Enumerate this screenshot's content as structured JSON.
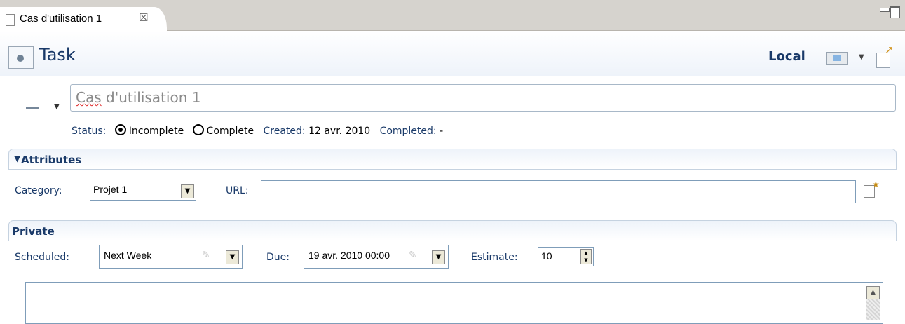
{
  "editor_tab": {
    "title": "Cas d'utilisation 1",
    "close_glyph": "☒"
  },
  "header": {
    "title": "Task",
    "repository": "Local"
  },
  "summary": {
    "value_spelled": "Cas",
    "value_rest": " d'utilisation 1"
  },
  "status": {
    "label": "Status:",
    "options": [
      "Incomplete",
      "Complete"
    ],
    "selected": "Incomplete",
    "created_label": "Created:",
    "created_value": "12 avr. 2010",
    "completed_label": "Completed:",
    "completed_value": "-"
  },
  "attributes": {
    "section_title": "Attributes",
    "category_label": "Category:",
    "category_value": "Projet 1",
    "url_label": "URL:",
    "url_value": ""
  },
  "private": {
    "section_title": "Private",
    "scheduled_label": "Scheduled:",
    "scheduled_value": "Next Week",
    "due_label": "Due:",
    "due_value": "19 avr. 2010 00:00",
    "estimate_label": "Estimate:",
    "estimate_value": "10",
    "notes_value": ""
  },
  "icons": {
    "tab": "document-icon",
    "header": "task-icon",
    "priority": "priority-icon",
    "url_open": "open-url-icon",
    "toolbar": [
      "calendar-icon",
      "export-icon"
    ]
  }
}
